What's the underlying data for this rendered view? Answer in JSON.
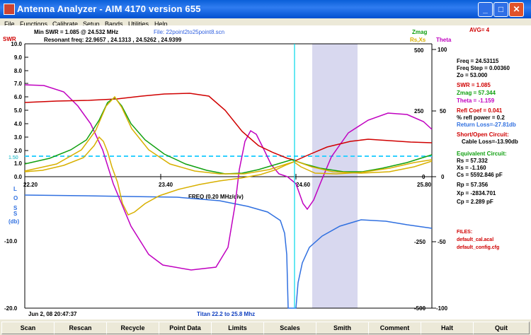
{
  "window": {
    "title": "Antenna Analyzer  -  AIM 4170 version 655"
  },
  "menu": [
    "File",
    "Functions",
    "Calibrate",
    "Setup",
    "Bands",
    "Utilities",
    "Help"
  ],
  "header": {
    "swr_label": "SWR",
    "min_swr": "Min SWR =  1.085 @  24.532 MHz",
    "file": "File: 22point2to25point8.scn",
    "resonant": "Resonant freq:  22.9657 , 24.1313 , 24.5262 , 24.9399",
    "zmag_label": "Zmag",
    "rsxs_label": "Rs,Xs",
    "theta_label": "Theta",
    "avg": "AVG=  4"
  },
  "axes": {
    "swr_ticks": [
      "10.0",
      "9.0",
      "8.0",
      "7.0",
      "6.0",
      "5.0",
      "4.0",
      "3.0",
      "2.0",
      "1.0",
      "0.0"
    ],
    "swr_ref": "1.50",
    "freq_ticks": [
      "22.20",
      "23.40",
      "24.60",
      "25.80"
    ],
    "freq_label": "FREQ (0.20 MHz/div)",
    "loss_letters": [
      "L",
      "O",
      "S",
      "S"
    ],
    "loss_unit": "(db)",
    "loss_ticks": [
      "-10.0",
      "-20.0"
    ],
    "z_ticks": [
      "500",
      "250",
      "0"
    ],
    "x_ticks": [
      "-250",
      "-500"
    ],
    "theta_ticks": [
      "100",
      "50",
      "0",
      "-50",
      "-100"
    ]
  },
  "readout": {
    "freq": "Freq =  24.53115",
    "step": "Freq Step =  0.00360",
    "zo": "Zo =  53.000",
    "swr": "SWR  =  1.085",
    "zmag": "Zmag  =  57.344",
    "theta": "Theta  =  -1.159",
    "refl_coef": "Refl Coef   = 0.041",
    "refl_power": "% refl power =  0.2",
    "return_loss": "Return Loss=-27.81db",
    "short_open": "Short/Open Circuit:",
    "cable_loss": "Cable Loss=-13.90db",
    "equiv": "Equivalent Circuit:",
    "rs": "Rs  =   57.332",
    "xs": "Xs  =   -1.160",
    "cs": "Cs = 5592.846  pF",
    "rp": "Rp  =   57.356",
    "xp": "Xp = -2834.701",
    "cp": "Cp  =    2.289  pF",
    "files": "FILES:",
    "cal": "default_cal.acal",
    "cfg": "default_config.cfg"
  },
  "footer": {
    "date": "Jun 2, 08  20:47:37",
    "titan": "Titan 22.2 to 25.8 Mhz"
  },
  "buttons": [
    "Scan",
    "Rescan",
    "Recycle",
    "Point Data",
    "Limits",
    "Scales",
    "Smith",
    "Comment",
    "Halt",
    "Quit"
  ],
  "colors": {
    "swr": "#d00000",
    "zmag": "#10a010",
    "rsxs": "#d8b000",
    "theta": "#c000c0",
    "loss": "#3070e0",
    "cursor": "#00d0e0",
    "band": "#d8d8ef"
  }
}
